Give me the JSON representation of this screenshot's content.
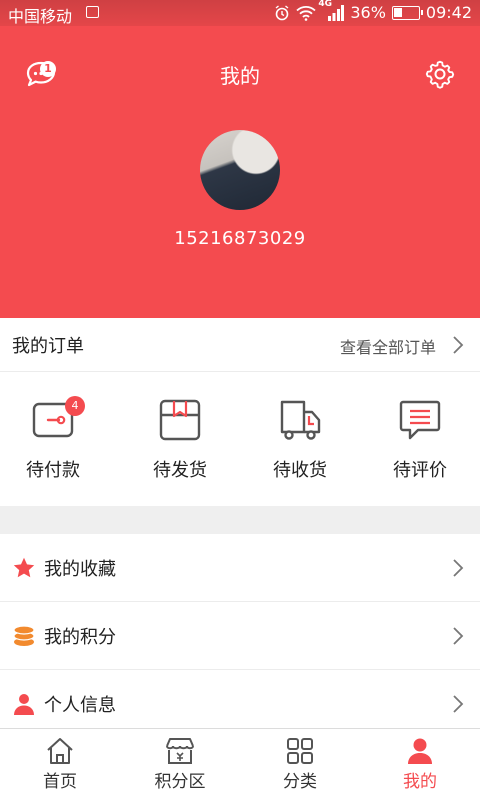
{
  "status_bar": {
    "carrier": "中国移动",
    "network": "4G",
    "battery": "36%",
    "battery_level": 0.36,
    "time": "09:42"
  },
  "header": {
    "title": "我的",
    "message_badge": "1",
    "phone": "15216873029"
  },
  "orders": {
    "title": "我的订单",
    "view_all": "查看全部订单",
    "items": [
      {
        "label": "待付款",
        "icon": "wallet-icon",
        "badge": "4"
      },
      {
        "label": "待发货",
        "icon": "box-icon"
      },
      {
        "label": "待收货",
        "icon": "truck-icon"
      },
      {
        "label": "待评价",
        "icon": "comment-icon"
      }
    ]
  },
  "menu": {
    "items": [
      {
        "label": "我的收藏",
        "icon": "star-icon"
      },
      {
        "label": "我的积分",
        "icon": "coins-icon"
      },
      {
        "label": "个人信息",
        "icon": "person-icon"
      }
    ]
  },
  "tabbar": {
    "items": [
      {
        "label": "首页",
        "icon": "home-icon"
      },
      {
        "label": "积分区",
        "icon": "shop-icon"
      },
      {
        "label": "分类",
        "icon": "grid-icon"
      },
      {
        "label": "我的",
        "icon": "user-icon",
        "active": true
      }
    ]
  },
  "colors": {
    "accent": "#f44b4f",
    "icon_gray": "#555555",
    "coins": "#f28a2e"
  }
}
